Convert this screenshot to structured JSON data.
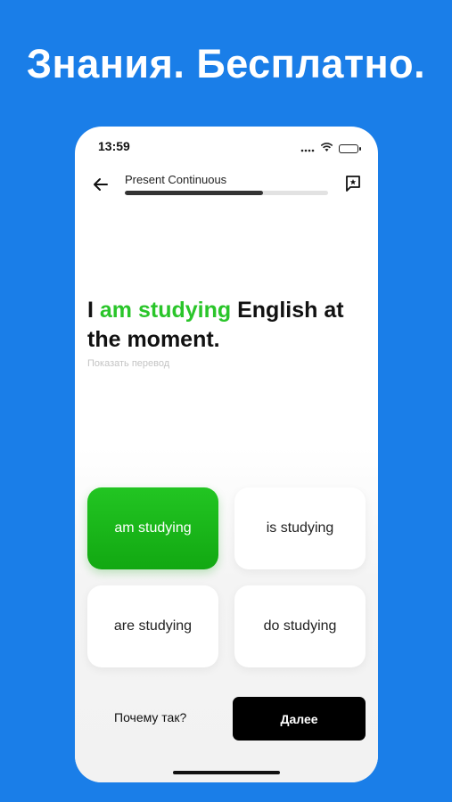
{
  "headline": "Знания. Бесплатно.",
  "status_bar": {
    "time": "13:59"
  },
  "header": {
    "lesson_title": "Present Continuous",
    "progress": 0.68
  },
  "sentence": {
    "before": "I ",
    "answer": "am studying",
    "after": " English at the moment."
  },
  "show_translation_label": "Показать перевод",
  "options": [
    {
      "label": "am studying",
      "correct": true
    },
    {
      "label": "is studying",
      "correct": false
    },
    {
      "label": "are studying",
      "correct": false
    },
    {
      "label": "do studying",
      "correct": false
    }
  ],
  "footer": {
    "why_label": "Почему так?",
    "next_label": "Далее"
  },
  "colors": {
    "background": "#1a7ee8",
    "correct": "#22c522",
    "answer_text": "#2ac52a"
  }
}
